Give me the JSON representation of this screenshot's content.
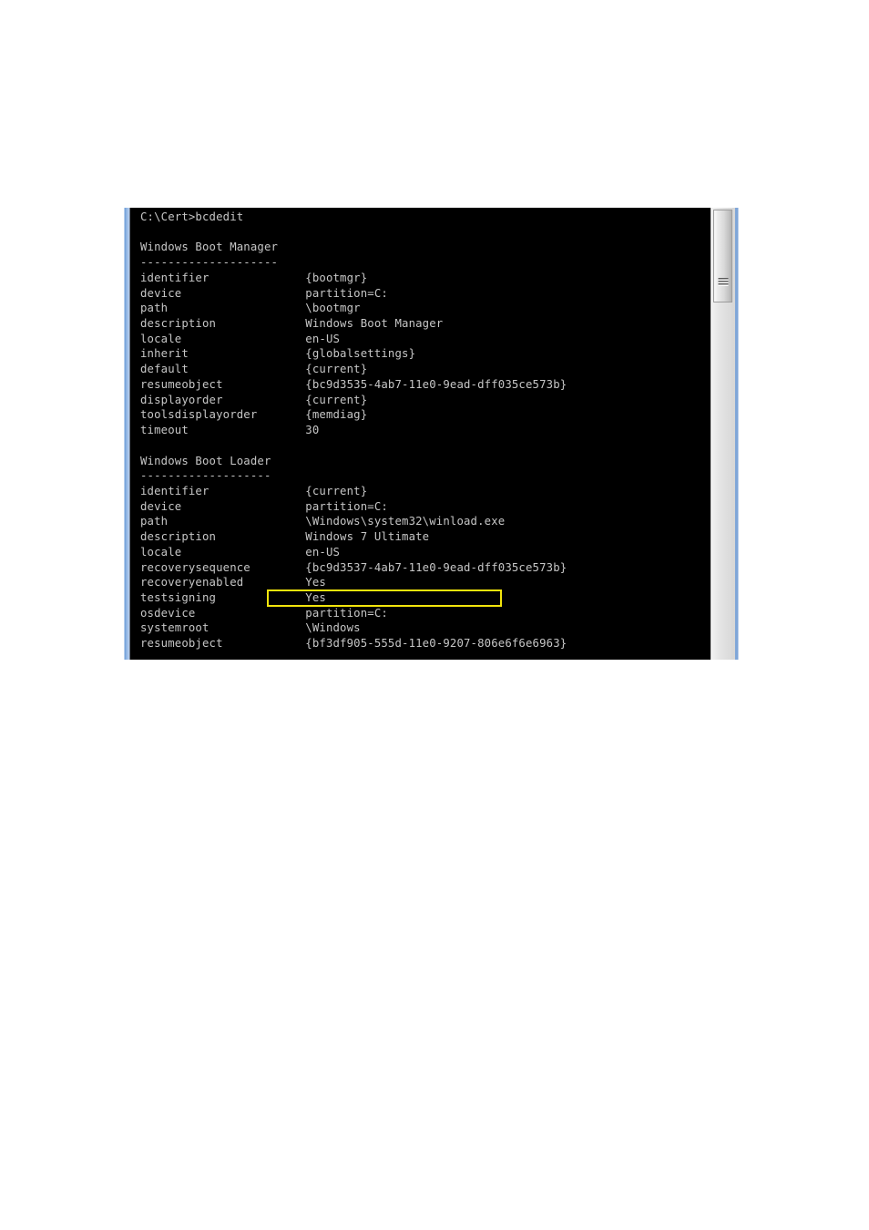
{
  "document": {
    "background_color": "#ffffff",
    "figure": {
      "type": "console-screenshot",
      "window_edge_color": "#7fa6d8",
      "console_background": "#000000",
      "console_foreground": "#c6c6c6",
      "highlight_color": "#f2e40c"
    }
  },
  "console": {
    "prompt_line": "C:\\Cert>bcdedit",
    "sections": [
      {
        "title": "Windows Boot Manager",
        "rule": "--------------------",
        "entries": [
          {
            "key": "identifier",
            "value": "{bootmgr}"
          },
          {
            "key": "device",
            "value": "partition=C:"
          },
          {
            "key": "path",
            "value": "\\bootmgr"
          },
          {
            "key": "description",
            "value": "Windows Boot Manager"
          },
          {
            "key": "locale",
            "value": "en-US"
          },
          {
            "key": "inherit",
            "value": "{globalsettings}"
          },
          {
            "key": "default",
            "value": "{current}"
          },
          {
            "key": "resumeobject",
            "value": "{bc9d3535-4ab7-11e0-9ead-dff035ce573b}"
          },
          {
            "key": "displayorder",
            "value": "{current}"
          },
          {
            "key": "toolsdisplayorder",
            "value": "{memdiag}"
          },
          {
            "key": "timeout",
            "value": "30"
          }
        ]
      },
      {
        "title": "Windows Boot Loader",
        "rule": "-------------------",
        "entries": [
          {
            "key": "identifier",
            "value": "{current}"
          },
          {
            "key": "device",
            "value": "partition=C:"
          },
          {
            "key": "path",
            "value": "\\Windows\\system32\\winload.exe"
          },
          {
            "key": "description",
            "value": "Windows 7 Ultimate"
          },
          {
            "key": "locale",
            "value": "en-US"
          },
          {
            "key": "recoverysequence",
            "value": "{bc9d3537-4ab7-11e0-9ead-dff035ce573b}"
          },
          {
            "key": "recoveryenabled",
            "value": "Yes"
          },
          {
            "key": "testsigning",
            "value": "Yes",
            "highlighted": true
          },
          {
            "key": "osdevice",
            "value": "partition=C:"
          },
          {
            "key": "systemroot",
            "value": "\\Windows"
          },
          {
            "key": "resumeobject",
            "value": "{bf3df905-555d-11e0-9207-806e6f6e6963}"
          }
        ]
      }
    ],
    "full_text": "C:\\Cert>bcdedit\n\nWindows Boot Manager\n--------------------\nidentifier              {bootmgr}\ndevice                  partition=C:\npath                    \\bootmgr\ndescription             Windows Boot Manager\nlocale                  en-US\ninherit                 {globalsettings}\ndefault                 {current}\nresumeobject            {bc9d3535-4ab7-11e0-9ead-dff035ce573b}\ndisplayorder            {current}\ntoolsdisplayorder       {memdiag}\ntimeout                 30\n\nWindows Boot Loader\n-------------------\nidentifier              {current}\ndevice                  partition=C:\npath                    \\Windows\\system32\\winload.exe\ndescription             Windows 7 Ultimate\nlocale                  en-US\nrecoverysequence        {bc9d3537-4ab7-11e0-9ead-dff035ce573b}\nrecoveryenabled         Yes\ntestsigning             Yes\nosdevice                partition=C:\nsystemroot              \\Windows\nresumeobject            {bf3df905-555d-11e0-9207-806e6f6e6963}"
  },
  "scrollbar": {
    "orientation": "vertical",
    "thumb_position": "top",
    "grip_icon": "scroll-grip-lines-icon"
  }
}
